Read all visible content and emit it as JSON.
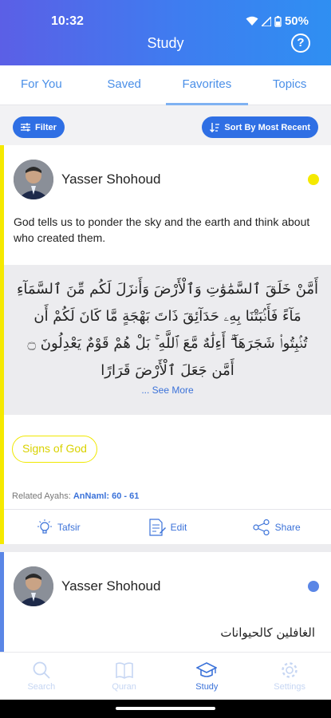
{
  "status": {
    "time": "10:32",
    "battery": "50%"
  },
  "header": {
    "title": "Study",
    "help_label": "?"
  },
  "tabs": [
    {
      "label": "For You"
    },
    {
      "label": "Saved"
    },
    {
      "label": "Favorites",
      "active": true
    },
    {
      "label": "Topics"
    }
  ],
  "toolbar": {
    "filter_label": "Filter",
    "sort_label": "Sort By Most Recent"
  },
  "cards": [
    {
      "author": "Yasser Shohoud",
      "dot_color": "#f5e900",
      "description": "God tells us to ponder the sky and the earth and think about who created them.",
      "arabic_lines": [
        "أَمَّنْ خَلَقَ ٱلسَّمَٰوَٰتِ وَٱلْأَرْضَ وَأَنزَلَ لَكُم مِّنَ ٱلسَّمَآءِ",
        "مَآءً فَأَنۢبَتْنَا بِهِۦ حَدَآئِقَ ذَاتَ بَهْجَةٍ مَّا كَانَ لَكُمْ أَن",
        "تُنۢبِتُوا۟ شَجَرَهَآ ۗ أَءِلَٰهٌ مَّعَ ٱللَّهِ ۚ بَلْ هُمْ قَوْمٌ يَعْدِلُونَ ۝",
        "أَمَّن جَعَلَ ٱلْأَرْضَ قَرَارًا"
      ],
      "see_more": "... See More",
      "tag": "Signs of God",
      "related_label": "Related Ayahs:",
      "related_value": "AnNaml: 60 - 61",
      "actions": {
        "tafsir": "Tafsir",
        "edit": "Edit",
        "share": "Share"
      }
    },
    {
      "author": "Yasser Shohoud",
      "dot_color": "#5a86e6",
      "arabic_text": "الغافلين كالحيوانات"
    }
  ],
  "bottom_nav": [
    {
      "label": "Search",
      "icon": "search-icon"
    },
    {
      "label": "Quran",
      "icon": "book-icon"
    },
    {
      "label": "Study",
      "icon": "graduation-cap-icon",
      "active": true
    },
    {
      "label": "Settings",
      "icon": "gear-icon"
    }
  ]
}
